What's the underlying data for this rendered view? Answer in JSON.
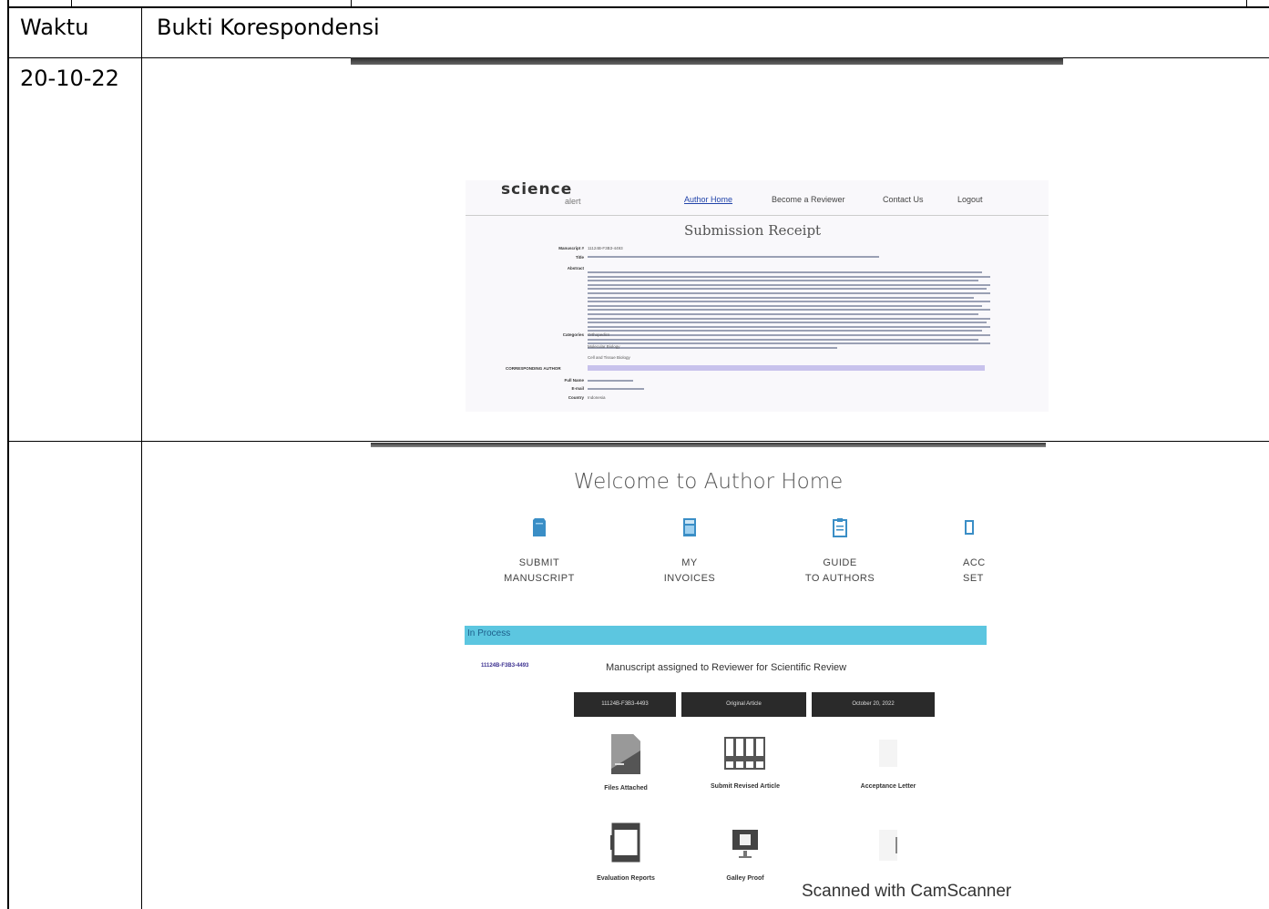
{
  "table": {
    "header_col1": "Waktu",
    "header_col2": "Bukti Korespondensi",
    "row1_date": "20-10-22",
    "row2_date": ""
  },
  "submission_receipt": {
    "logo": "science",
    "logo_sub": "alert",
    "nav": [
      "Author Home",
      "Become a Reviewer",
      "Contact Us",
      "Logout"
    ],
    "title": "Submission Receipt",
    "fields": [
      {
        "label": "Manuscript #",
        "value": "11124B-F3B3-4493"
      },
      {
        "label": "Title",
        "value": ""
      },
      {
        "label": "Abstract",
        "value": ""
      },
      {
        "label": "Categories",
        "value": "Orthopedics"
      },
      {
        "label": "",
        "value": "Molecular Biology"
      },
      {
        "label": "",
        "value": "Cell and Tissue Biology"
      }
    ],
    "corresponding_label": "CORRESPONDING AUTHOR",
    "author_fields": [
      {
        "label": "Full Name",
        "value": ""
      },
      {
        "label": "E-mail",
        "value": ""
      },
      {
        "label": "Country",
        "value": "Indonesia"
      }
    ]
  },
  "author_home": {
    "title": "Welcome to Author Home",
    "menu": [
      {
        "label": "SUBMIT\nMANUSCRIPT",
        "icon": "document-icon"
      },
      {
        "label": "MY\nINVOICES",
        "icon": "calculator-icon"
      },
      {
        "label": "GUIDE\nTO AUTHORS",
        "icon": "clipboard-icon"
      },
      {
        "label": "ACC\nSET",
        "icon": "settings-icon"
      }
    ],
    "status_bar_label": "In Process",
    "manuscript_link": "11124B-F3B3-4493",
    "status_message": "Manuscript assigned to Reviewer for Scientific Review",
    "chips": [
      "11124B-F3B3-4493",
      "Original Article",
      "October 20, 2022"
    ],
    "actions": [
      "Files Attached",
      "Submit Revised Article",
      "Acceptance Letter",
      "Evaluation Reports",
      "Galley Proof",
      ""
    ],
    "watermark": "Scanned with CamScanner"
  },
  "colors": {
    "status_bar": "#5cc6e0",
    "icon_blue": "#3a8ec6",
    "chip_bg": "#2a2a2a"
  }
}
